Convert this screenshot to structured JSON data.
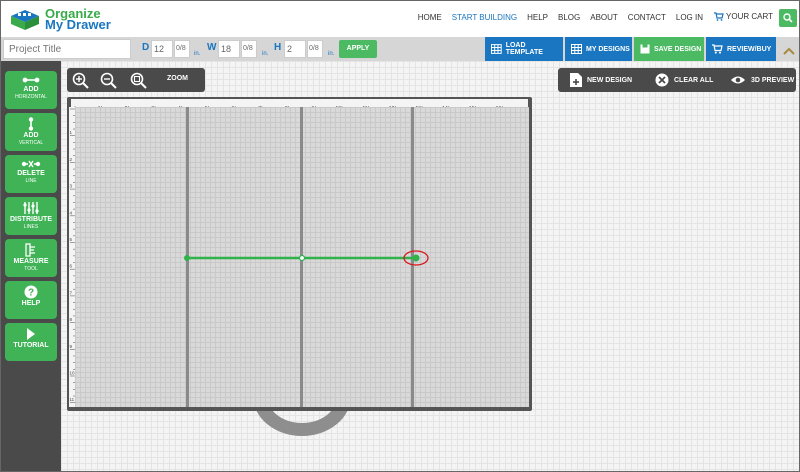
{
  "brand": {
    "line1": "Organize",
    "line2": "My Drawer"
  },
  "nav": {
    "links": [
      "HOME",
      "START BUILDING",
      "HELP",
      "BLOG",
      "ABOUT",
      "CONTACT",
      "LOG IN"
    ],
    "active": "START BUILDING",
    "cart_label": "YOUR CART"
  },
  "toolbar": {
    "project_placeholder": "Project Title",
    "depth": {
      "label": "D",
      "value": "12",
      "fraction": "0/8",
      "unit": "in."
    },
    "width": {
      "label": "W",
      "value": "18",
      "fraction": "0/8",
      "unit": "in."
    },
    "height": {
      "label": "H",
      "value": "2",
      "fraction": "0/8",
      "unit": "in."
    },
    "apply": "APPLY",
    "load_template": "LOAD TEMPLATE",
    "my_designs": "MY DESIGNS",
    "save_design": "SAVE DESIGN",
    "review_buy": "REVIEW/BUY"
  },
  "sidebar": {
    "items": [
      {
        "label": "ADD",
        "sub": "HORIZONTAL",
        "icon": "horizontal-line-icon"
      },
      {
        "label": "ADD",
        "sub": "VERTICAL",
        "icon": "vertical-line-icon"
      },
      {
        "label": "DELETE",
        "sub": "LINE",
        "icon": "delete-line-icon"
      },
      {
        "label": "DISTRIBUTE",
        "sub": "LINES",
        "icon": "distribute-icon"
      },
      {
        "label": "MEASURE",
        "sub": "TOOL",
        "icon": "measure-icon"
      },
      {
        "label": "HELP",
        "sub": "",
        "icon": "help-icon"
      },
      {
        "label": "TUTORIAL",
        "sub": "",
        "icon": "play-icon"
      }
    ]
  },
  "canvas_tools": {
    "zoom_label": "ZOOM",
    "new_design": "NEW DESIGN",
    "clear_all": "CLEAR ALL",
    "preview_3d": "3D PREVIEW"
  },
  "ruler_top": [
    "1",
    "2",
    "3",
    "4",
    "5",
    "6",
    "7",
    "8",
    "9",
    "10",
    "11",
    "12",
    "13",
    "14",
    "15",
    "16",
    "17"
  ],
  "ruler_left": [
    "1",
    "2",
    "3",
    "4",
    "5",
    "6",
    "7",
    "8",
    "9",
    "10",
    "11"
  ],
  "colors": {
    "accent_green": "#3fb356",
    "accent_blue": "#1a76c0",
    "highlight": "#d9181f"
  }
}
